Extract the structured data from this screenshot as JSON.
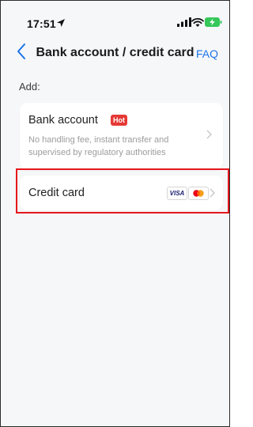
{
  "status_bar": {
    "time": "17:51",
    "icons": [
      "location-arrow-icon",
      "signal-icon",
      "wifi-icon",
      "battery-charging-icon"
    ]
  },
  "header": {
    "back_icon": "chevron-left-icon",
    "title": "Bank account / credit card",
    "faq_label": "FAQ"
  },
  "section": {
    "add_label": "Add:"
  },
  "options": [
    {
      "label": "Bank account",
      "badge": "Hot",
      "description": "No handling fee, instant transfer and supervised by regulatory authorities"
    },
    {
      "label": "Credit card",
      "card_logos": [
        "VISA",
        "mastercard-icon"
      ]
    }
  ],
  "colors": {
    "accent": "#1a73e8",
    "badge": "#e53935",
    "highlight": "#e5171c",
    "background": "#f6f7f9"
  }
}
